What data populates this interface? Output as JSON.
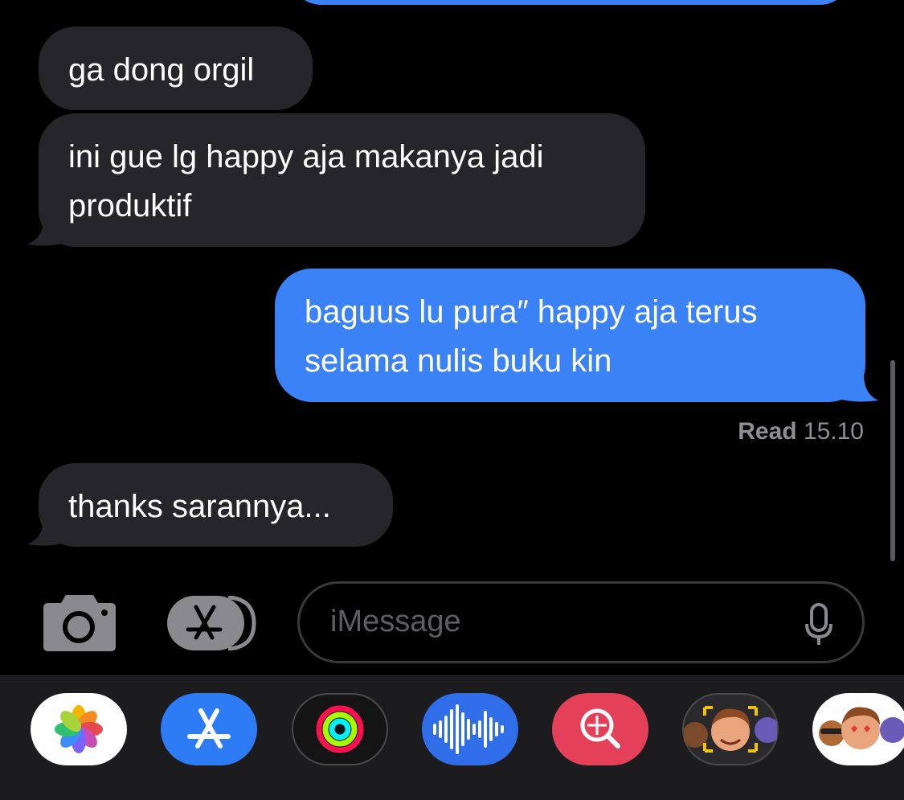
{
  "messages": [
    {
      "direction": "in",
      "text": "ga dong orgil"
    },
    {
      "direction": "in",
      "text": "ini gue lg happy aja makanya jadi\nproduktif"
    },
    {
      "direction": "out",
      "text": "baguus lu pura″ happy aja terus\nselama nulis buku kin"
    },
    {
      "direction": "in",
      "text": "thanks sarannya..."
    }
  ],
  "receipt": {
    "status": "Read",
    "time": "15.10"
  },
  "compose": {
    "placeholder": "iMessage"
  },
  "icons": {
    "camera": "camera-icon",
    "apps": "app-store-icon",
    "mic": "microphone-icon"
  },
  "app_drawer": [
    {
      "name": "photos",
      "icon": "photos-icon"
    },
    {
      "name": "app-store",
      "icon": "app-store-icon"
    },
    {
      "name": "activity",
      "icon": "activity-rings-icon"
    },
    {
      "name": "audio",
      "icon": "audio-waveform-icon"
    },
    {
      "name": "images-search",
      "icon": "globe-search-icon"
    },
    {
      "name": "memoji",
      "icon": "memoji-icon"
    },
    {
      "name": "memoji-stickers",
      "icon": "memoji-stickers-icon"
    }
  ],
  "colors": {
    "incoming_bubble": "#26252a",
    "outgoing_bubble": "#3b82f6",
    "background": "#000000",
    "muted_text": "#8e8e93"
  }
}
